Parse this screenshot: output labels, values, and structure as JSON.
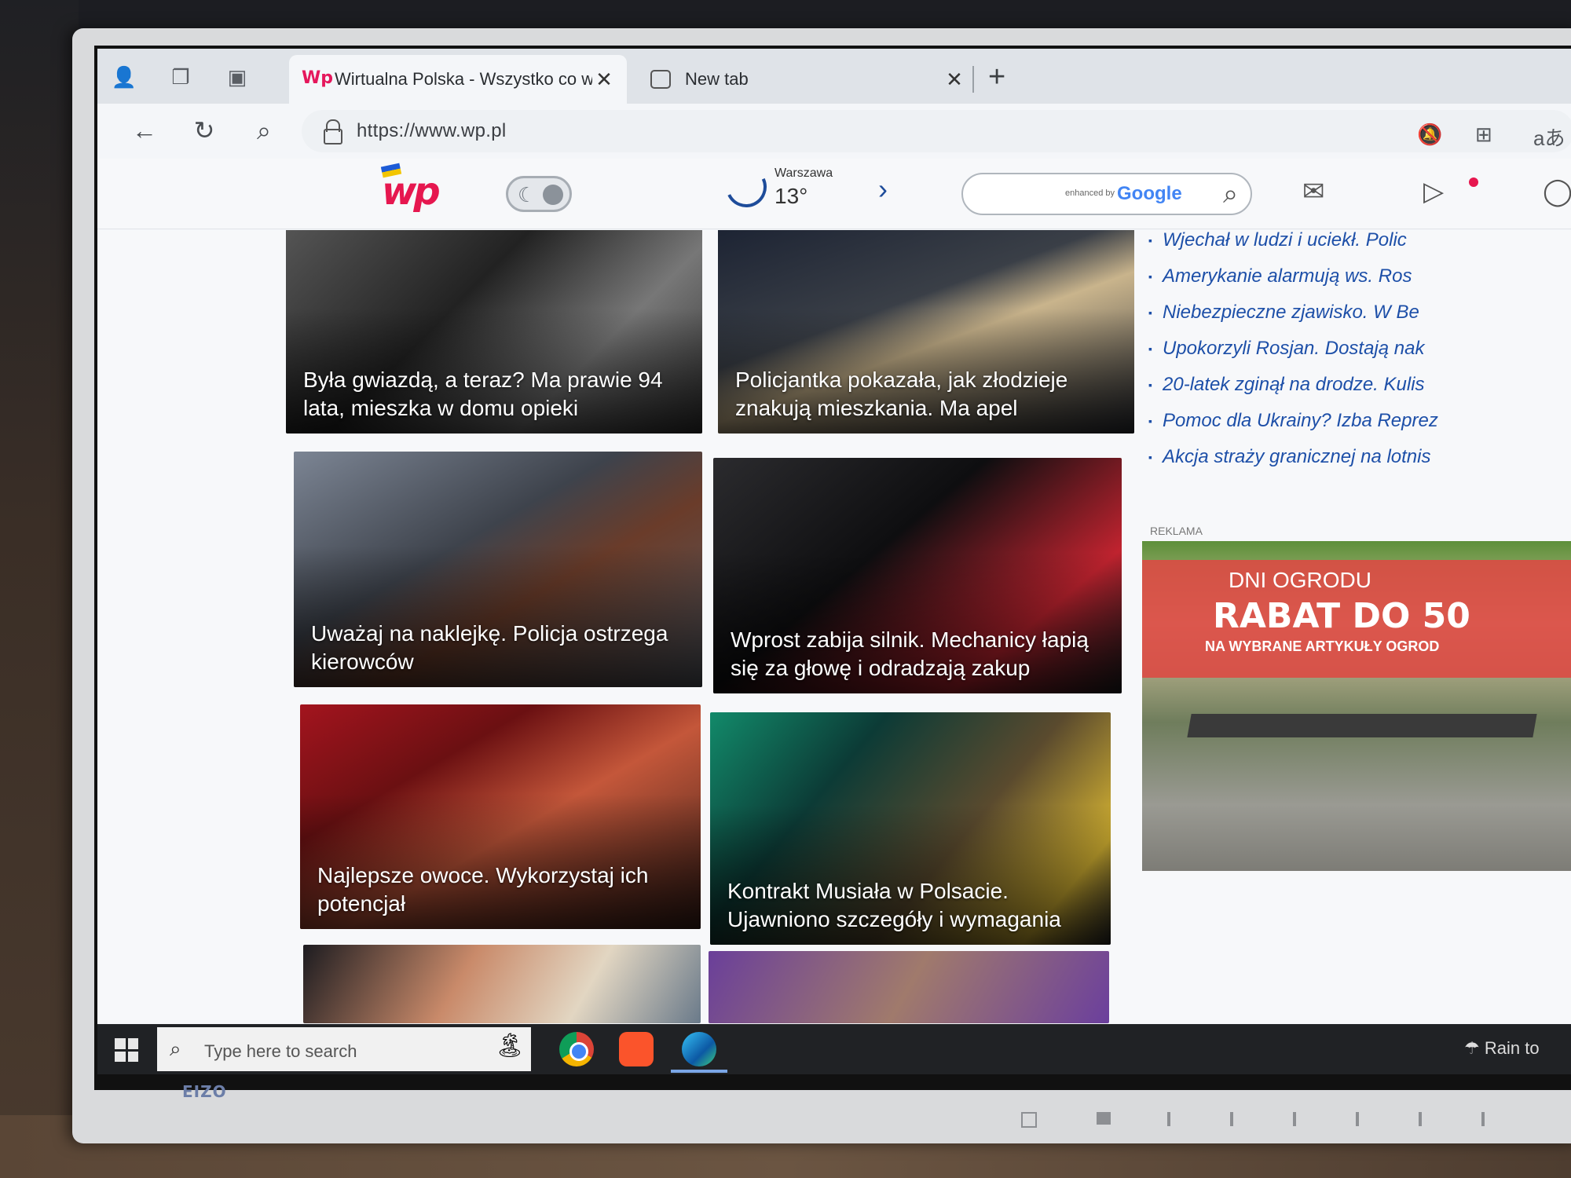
{
  "browser": {
    "tabs": [
      {
        "title": "Wirtualna Polska - Wszystko co w",
        "favicon": "wp-logo",
        "active": true
      },
      {
        "title": "New tab",
        "favicon": "new-tab-icon",
        "active": false
      }
    ],
    "url": "https://www.wp.pl"
  },
  "header": {
    "logo": "wp",
    "weather": {
      "city": "Warszawa",
      "temperature": "13°"
    },
    "search": {
      "enhanced_by": "enhanced by",
      "provider": "Google"
    }
  },
  "articles": [
    {
      "caption": "Była gwiazdą, a teraz? Ma prawie 94 lata, mieszka w domu opieki"
    },
    {
      "caption": "Policjantka pokazała, jak złodzieje znakują mieszkania. Ma apel"
    },
    {
      "caption": "Uważaj na naklejkę. Policja ostrzega kierowców"
    },
    {
      "caption": "Wprost zabija silnik. Mechanicy łapią się za głowę i odradzają zakup"
    },
    {
      "caption": "Najlepsze owoce. Wykorzystaj ich potencjał"
    },
    {
      "caption": "Kontrakt Musiała w Polsacie. Ujawniono szczegóły i wymagania"
    },
    {
      "caption": ""
    },
    {
      "caption": ""
    }
  ],
  "news": [
    "Wjechał w ludzi i uciekł. Polic",
    "Amerykanie alarmują ws. Ros",
    "Niebezpieczne zjawisko. W Be",
    "Upokorzyli Rosjan. Dostają nak",
    "20-latek zginął na drodze. Kulis",
    "Pomoc dla Ukrainy? Izba Reprez",
    "Akcja straży granicznej na lotnis"
  ],
  "ad": {
    "label": "REKLAMA",
    "line1": "DNI OGRODU",
    "line2": "RABAT DO 50",
    "line3": "NA WYBRANE ARTYKUŁY OGROD"
  },
  "taskbar": {
    "search_placeholder": "Type here to search",
    "weather": "Rain to"
  },
  "monitor_brand": "EIZO",
  "colors": {
    "wp_red": "#e6174f",
    "link_blue": "#1d4fa8"
  }
}
